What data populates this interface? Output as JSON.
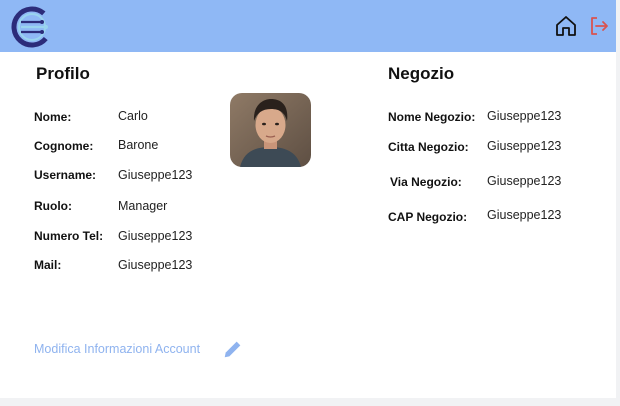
{
  "colors": {
    "header_bg": "#8fb8f5",
    "accent": "#8fb3ef",
    "logout": "#d9534f",
    "logo_dark": "#2c2c7a",
    "logo_light": "#9ad4ef"
  },
  "header": {
    "logo_icon": "app-logo",
    "home_icon": "home-icon",
    "logout_icon": "logout-icon"
  },
  "profile": {
    "title": "Profilo",
    "fields": [
      {
        "label": "Nome:",
        "value": "Carlo"
      },
      {
        "label": "Cognome:",
        "value": "Barone"
      },
      {
        "label": "Username:",
        "value": "Giuseppe123"
      },
      {
        "label": "Ruolo:",
        "value": "Manager"
      },
      {
        "label": "Numero Tel:",
        "value": "Giuseppe123"
      },
      {
        "label": "Mail:",
        "value": "Giuseppe123"
      }
    ],
    "edit_link": "Modifica Informazioni Account",
    "edit_icon": "pencil-icon"
  },
  "store": {
    "title": "Negozio",
    "fields": [
      {
        "label": "Nome Negozio:",
        "value": "Giuseppe123"
      },
      {
        "label": "Citta Negozio:",
        "value": "Giuseppe123"
      },
      {
        "label": "Via Negozio:",
        "value": "Giuseppe123"
      },
      {
        "label": "CAP Negozio:",
        "value": "Giuseppe123"
      }
    ]
  }
}
